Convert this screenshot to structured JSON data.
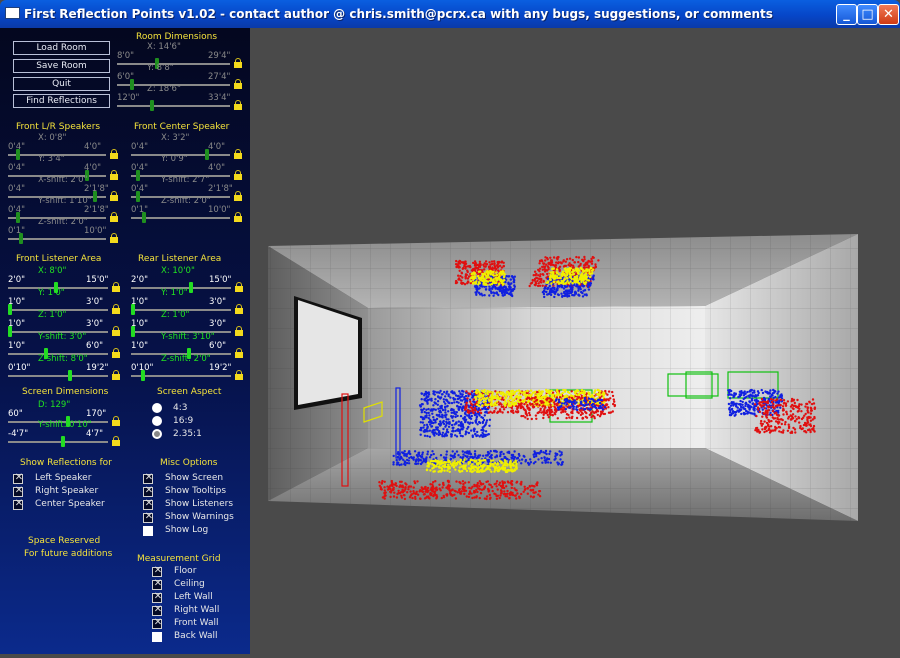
{
  "window": {
    "title": "First Reflection Points v1.02 - contact author @ chris.smith@pcrx.ca with any bugs, suggestions, or comments",
    "min": "_",
    "max": "□",
    "close": "✕"
  },
  "buttons": {
    "load": "Load Room",
    "save": "Save Room",
    "quit": "Quit",
    "find": "Find Reflections"
  },
  "room": {
    "title": "Room Dimensions",
    "sliders": [
      {
        "min": "8'0\"",
        "label": "X: 14'6\"",
        "max": "29'4\"",
        "pos": 0.35
      },
      {
        "min": "6'0\"",
        "label": "Y: 8'8\"",
        "max": "27'4\"",
        "pos": 0.12
      },
      {
        "min": "12'0\"",
        "label": "Z: 18'6\"",
        "max": "33'4\"",
        "pos": 0.3
      }
    ]
  },
  "front_lr": {
    "title": "Front L/R Speakers",
    "sliders": [
      {
        "min": "0'4\"",
        "label": "X: 0'8\"",
        "max": "4'0\"",
        "pos": 0.08
      },
      {
        "min": "0'4\"",
        "label": "Y: 3'4\"",
        "max": "4'0\"",
        "pos": 0.82
      },
      {
        "min": "0'4\"",
        "label": "X-shift: 2'0\"",
        "max": "2'1'8\"",
        "pos": 0.9
      },
      {
        "min": "0'4\"",
        "label": "Y-shift: 1'10\"",
        "max": "2'1'8\"",
        "pos": 0.08
      },
      {
        "min": "0'1\"",
        "label": "Z-shift: 2'0\"",
        "max": "10'0\"",
        "pos": 0.12
      }
    ]
  },
  "front_center": {
    "title": "Front Center Speaker",
    "sliders": [
      {
        "min": "0'4\"",
        "label": "X: 3'2\"",
        "max": "4'0\"",
        "pos": 0.78
      },
      {
        "min": "0'4\"",
        "label": "Y: 0'9\"",
        "max": "4'0\"",
        "pos": 0.05
      },
      {
        "min": "0'4\"",
        "label": "Y-shift: 2'7\"",
        "max": "2'1'8\"",
        "pos": 0.05
      },
      {
        "min": "0'1\"",
        "label": "Z-shift: 2'0\"",
        "max": "10'0\"",
        "pos": 0.12
      }
    ]
  },
  "front_listener": {
    "title": "Front Listener Area",
    "sliders": [
      {
        "min": "2'0\"",
        "label": "X: 8'0\"",
        "max": "15'0\"",
        "pos": 0.48
      },
      {
        "min": "1'0\"",
        "label": "Y: 1'0\"",
        "max": "3'0\"",
        "pos": 0.0
      },
      {
        "min": "1'0\"",
        "label": "Z: 1'0\"",
        "max": "3'0\"",
        "pos": 0.0
      },
      {
        "min": "1'0\"",
        "label": "Y-shift: 3'0\"",
        "max": "6'0\"",
        "pos": 0.38
      },
      {
        "min": "0'10\"",
        "label": "Z-shift: 8'0\"",
        "max": "19'2\"",
        "pos": 0.62
      }
    ]
  },
  "rear_listener": {
    "title": "Rear Listener Area",
    "sliders": [
      {
        "min": "2'0\"",
        "label": "X: 10'0\"",
        "max": "15'0\"",
        "pos": 0.6
      },
      {
        "min": "1'0\"",
        "label": "Y: 1'0\"",
        "max": "3'0\"",
        "pos": 0.0
      },
      {
        "min": "1'0\"",
        "label": "Z: 1'0\"",
        "max": "3'0\"",
        "pos": 0.0
      },
      {
        "min": "1'0\"",
        "label": "Y-shift: 3'10\"",
        "max": "6'0\"",
        "pos": 0.58
      },
      {
        "min": "0'10\"",
        "label": "Z-shift: 2'0\"",
        "max": "19'2\"",
        "pos": 0.1
      }
    ]
  },
  "screen_dims": {
    "title": "Screen Dimensions",
    "sliders": [
      {
        "min": "60\"",
        "label": "D: 129\"",
        "max": "170\"",
        "pos": 0.6
      },
      {
        "min": "-4'7\"",
        "label": "Y-shift: 0'10\"",
        "max": "4'7\"",
        "pos": 0.55
      }
    ]
  },
  "aspect": {
    "title": "Screen Aspect",
    "options": [
      "4:3",
      "16:9",
      "2.35:1"
    ],
    "selected": 2
  },
  "reflections": {
    "title": "Show Reflections for",
    "items": [
      {
        "label": "Left Speaker",
        "on": true
      },
      {
        "label": "Right Speaker",
        "on": true
      },
      {
        "label": "Center Speaker",
        "on": true
      }
    ]
  },
  "misc": {
    "title": "Misc Options",
    "items": [
      {
        "label": "Show Screen",
        "on": true
      },
      {
        "label": "Show Tooltips",
        "on": true
      },
      {
        "label": "Show Listeners",
        "on": true
      },
      {
        "label": "Show Warnings",
        "on": true
      },
      {
        "label": "Show Log",
        "on": false
      }
    ]
  },
  "space": {
    "line1": "Space Reserved",
    "line2": "For future additions"
  },
  "grid": {
    "title": "Measurement Grid",
    "items": [
      {
        "label": "Floor",
        "on": true
      },
      {
        "label": "Ceiling",
        "on": true
      },
      {
        "label": "Left Wall",
        "on": true
      },
      {
        "label": "Right Wall",
        "on": true
      },
      {
        "label": "Front Wall",
        "on": true
      },
      {
        "label": "Back Wall",
        "on": false
      }
    ]
  },
  "colors": {
    "left": "#e01010",
    "right": "#1020e0",
    "center": "#f0f000",
    "listener": "#10c010"
  }
}
